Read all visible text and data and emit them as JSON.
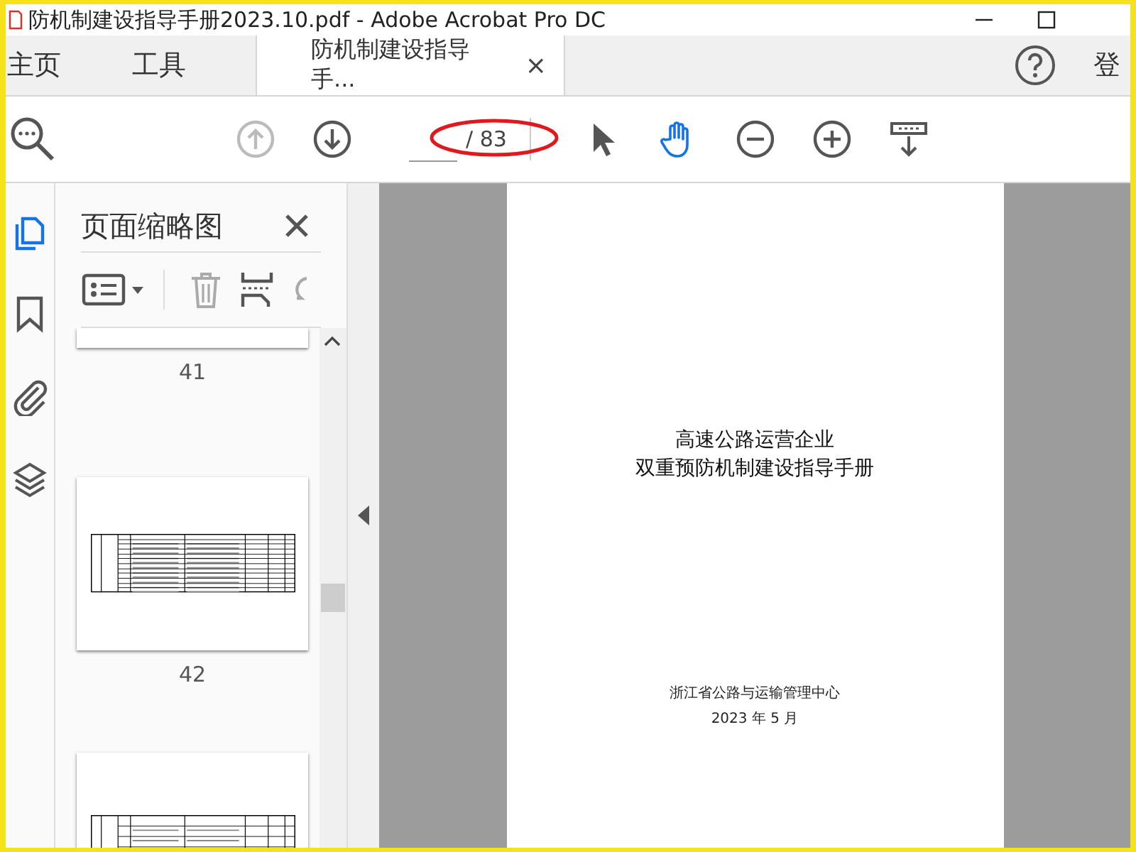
{
  "window": {
    "title": "防机制建设指导手册2023.10.pdf - Adobe Acrobat Pro DC"
  },
  "tabs": [
    {
      "label": "主页",
      "selected": false,
      "kind": "nav"
    },
    {
      "label": "工具",
      "selected": false,
      "kind": "nav"
    },
    {
      "label": "防机制建设指导手...",
      "selected": true,
      "kind": "document",
      "close": "×"
    }
  ],
  "sign_in": "登",
  "toolbar": {
    "page_total": "/ 83",
    "tools": [
      {
        "kind": "prev",
        "disabled": true
      },
      {
        "kind": "next",
        "disabled": false
      },
      {
        "kind": "page"
      },
      {
        "kind": "select",
        "selected": false
      },
      {
        "kind": "hand",
        "selected": true
      },
      {
        "kind": "zoom-out",
        "selected": false
      },
      {
        "kind": "zoom-in",
        "selected": false
      },
      {
        "kind": "scroll-mode",
        "selected": false
      }
    ]
  },
  "side_tabs": [
    {
      "kind": "pages",
      "selected": true
    },
    {
      "kind": "bookmarks",
      "selected": false
    },
    {
      "kind": "attachments",
      "selected": false
    },
    {
      "kind": "layers",
      "selected": false
    }
  ],
  "panel": {
    "title": "页面缩略图",
    "thumbnails": [
      {
        "label": "41",
        "kind": "cut-top"
      },
      {
        "label": "42",
        "kind": "table"
      },
      {
        "kind": "cut-bottom"
      }
    ]
  },
  "page": {
    "title_lines": [
      "高速公路运营企业",
      "双重预防机制建设指导手册"
    ],
    "publisher": "浙江省公路与运输管理中心",
    "date": "2023 年 5 月"
  }
}
